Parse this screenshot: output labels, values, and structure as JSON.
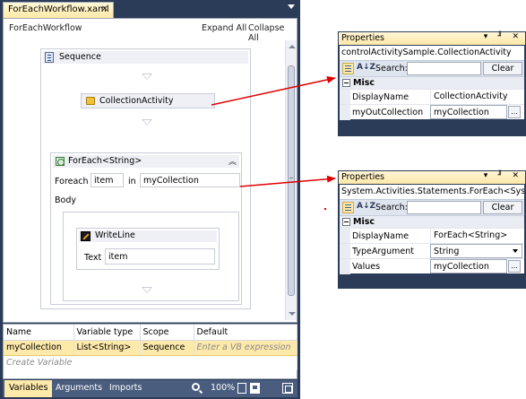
{
  "designer": {
    "tab": "ForEachWorkflow.xaml",
    "breadcrumb": "ForEachWorkflow",
    "expand_all": "Expand All",
    "collapse_all": "Collapse All",
    "sequence_title": "Sequence",
    "collection_activity": "CollectionActivity",
    "foreach": {
      "title": "ForEach<String>",
      "foreach_label": "Foreach",
      "item": "item",
      "in_label": "in",
      "collection": "myCollection",
      "body_label": "Body"
    },
    "writeline": {
      "title": "WriteLine",
      "text_label": "Text",
      "text_value": "item"
    }
  },
  "variables": {
    "columns": [
      "Name",
      "Variable type",
      "Scope",
      "Default"
    ],
    "row": {
      "name": "myCollection",
      "type": "List<String>",
      "scope": "Sequence",
      "default": "Enter a VB expression"
    },
    "create": "Create Variable"
  },
  "statusbar": {
    "tabs": [
      "Variables",
      "Arguments",
      "Imports"
    ],
    "zoom": "100%"
  },
  "properties1": {
    "title": "Properties",
    "title_buttons": "▾ ╜ ✕",
    "object": "controlActivitySample.CollectionActivity",
    "search_label": "Search:",
    "clear": "Clear",
    "category": "Misc",
    "rows": [
      {
        "name": "DisplayName",
        "value": "CollectionActivity"
      },
      {
        "name": "myOutCollection",
        "value": "myCollection"
      }
    ]
  },
  "properties2": {
    "title": "Properties",
    "title_buttons": "▾ ╜ ✕",
    "object": "System.Activities.Statements.ForEach<Syste...",
    "search_label": "Search:",
    "clear": "Clear",
    "category": "Misc",
    "rows": [
      {
        "name": "DisplayName",
        "value": "ForEach<String>"
      },
      {
        "name": "TypeArgument",
        "value": "String"
      },
      {
        "name": "Values",
        "value": "myCollection"
      }
    ]
  },
  "colors": {
    "frame": "#2b3c59",
    "accent": "#fde9a9",
    "arrow": "#e00000"
  },
  "icons": [
    "sequence-icon",
    "collection-activity-icon",
    "foreach-icon",
    "writeline-icon",
    "zoom-icon",
    "categorized-icon",
    "sort-az-icon"
  ]
}
